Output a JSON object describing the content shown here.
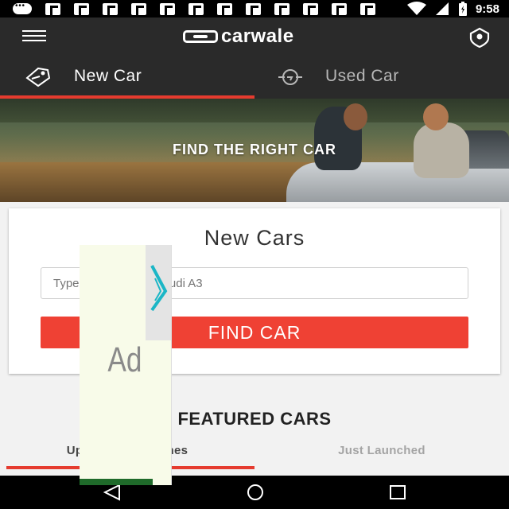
{
  "status_bar": {
    "time": "9:58",
    "icons": [
      "chat-icon",
      "flipboard-icon",
      "wifi-icon",
      "battery-icon"
    ]
  },
  "app_bar": {
    "brand_name": "carwale",
    "icons": [
      "menu-icon",
      "location-icon"
    ]
  },
  "tabs": [
    {
      "label": "New Car",
      "active": true,
      "icon": "new-car-tag-icon"
    },
    {
      "label": "Used Car",
      "active": false,
      "icon": "used-car-icon"
    }
  ],
  "hero": {
    "title": "FIND THE RIGHT CAR"
  },
  "search_card": {
    "title": "New Cars",
    "placeholder": "Type car name, e.g. Audi A3",
    "button_label": "FIND CAR"
  },
  "featured": {
    "title": "FEATURED CARS",
    "tabs": [
      {
        "label": "Upcoming Launches",
        "active": true
      },
      {
        "label": "Just Launched",
        "active": false
      }
    ]
  },
  "ad": {
    "label": "Ad"
  },
  "colors": {
    "accent": "#e53b2f",
    "button": "#ef4134",
    "toolbar": "#2a2a2a"
  }
}
